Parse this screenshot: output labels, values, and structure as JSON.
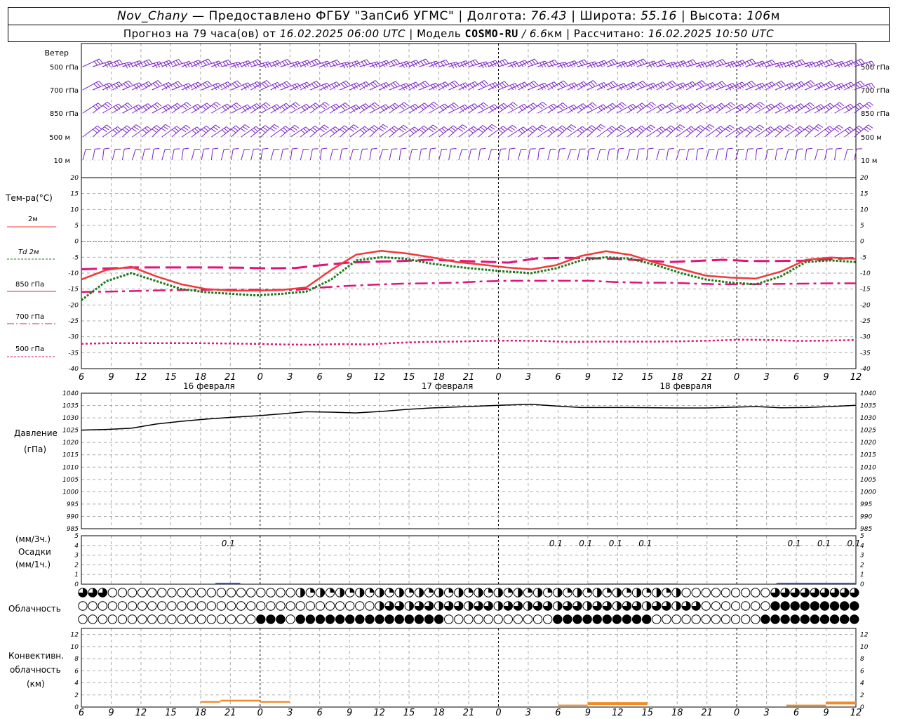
{
  "header": {
    "station": "Nov_Chany",
    "provider": "— Предоставлено ФГБУ \"ЗапСиб УГМС\"",
    "lon_label": "Долгота:",
    "lon_value": "76.43",
    "lat_label": "Широта:",
    "lat_value": "55.16",
    "alt_label": "Высота:",
    "alt_value": "106",
    "alt_unit": "м",
    "forecast_prefix": "Прогноз на 79 часа(ов) от",
    "forecast_time": "16.02.2025 06:00 UTC",
    "model_label": "| Модель",
    "model_name": "COSMO-RU",
    "model_res": "/ 6.6",
    "model_res_unit": "км",
    "computed_label": "| Рассчитано:",
    "computed_time": "16.02.2025 10:50 UTC"
  },
  "wind_panel": {
    "title": "Ветер",
    "levels": [
      "500 гПа",
      "700 гПа",
      "850 гПа",
      "500 м",
      "10  м"
    ]
  },
  "temp_panel": {
    "title": "Тем-ра(°C)",
    "legend": [
      {
        "label": "2м",
        "color": "#ee3a3a"
      },
      {
        "label": "Td  2м",
        "color": "#1a7a1a"
      },
      {
        "label": "850 гПа",
        "color": "#e0137a"
      },
      {
        "label": "700 гПа",
        "color": "#e0137a"
      },
      {
        "label": "500 гПа",
        "color": "#e0137a"
      }
    ],
    "y_ticks": [
      20,
      15,
      10,
      5,
      0,
      -5,
      -10,
      -15,
      -20,
      -25,
      -30,
      -35,
      -40
    ]
  },
  "pressure_panel": {
    "title": "Давление",
    "unit": "(гПа)",
    "y_ticks": [
      1040,
      1035,
      1030,
      1025,
      1020,
      1015,
      1010,
      1005,
      1000,
      995,
      990,
      985
    ]
  },
  "precip_panel": {
    "unit1": "(мм/3ч.)",
    "title": "Осадки",
    "unit2": "(мм/1ч.)",
    "y_ticks": [
      5,
      4,
      3,
      2,
      1,
      0
    ],
    "labels": [
      "0.1",
      "0.1",
      "0.1",
      "0.1",
      "0.1",
      "0.1",
      "0.1",
      "0.1"
    ]
  },
  "cloud_panel": {
    "title": "Облачность"
  },
  "conv_panel": {
    "title": [
      "Конвективн.",
      "облачность",
      "(км)"
    ],
    "y_ticks": [
      12,
      10,
      8,
      6,
      4,
      2,
      0
    ]
  },
  "x_axis": {
    "tick_labels": [
      "6",
      "9",
      "12",
      "15",
      "18",
      "21",
      "0",
      "3",
      "6",
      "9",
      "12",
      "15",
      "18",
      "21",
      "0",
      "3",
      "6",
      "9",
      "12",
      "15",
      "18",
      "21",
      "0",
      "3",
      "6",
      "9",
      "12"
    ],
    "dates": [
      "16 февраля",
      "17 февраля",
      "18 февраля"
    ]
  },
  "chart_data": {
    "type": "line",
    "x_hours": [
      0,
      3,
      6,
      9,
      12,
      15,
      18,
      21,
      24,
      27,
      30,
      33,
      36,
      39,
      42,
      45,
      48,
      51,
      54,
      57,
      60,
      63,
      66,
      69,
      72,
      75,
      78
    ],
    "series": [
      {
        "name": "2м",
        "color": "#ee3a3a",
        "values": [
          -12,
          -9,
          -8,
          -11,
          -13.5,
          -15,
          -15.5,
          -15.5,
          -15.3,
          -14.5,
          -9,
          -4.2,
          -3,
          -3.8,
          -5,
          -6.5,
          -7.3,
          -8.2,
          -8.8,
          -7.5,
          -4.6,
          -3.1,
          -4.3,
          -6.8,
          -8.7,
          -10.8,
          -11.4,
          -11.7,
          -9.5,
          -5.8,
          -5.1,
          -5.5
        ]
      },
      {
        "name": "Td  2м",
        "color": "#1a7a1a",
        "values": [
          -18.5,
          -12.5,
          -10,
          -12.5,
          -15,
          -16,
          -16.5,
          -17,
          -16.5,
          -15.8,
          -12,
          -6,
          -5,
          -5.5,
          -7,
          -8,
          -8.8,
          -9.5,
          -10,
          -8.5,
          -6,
          -5,
          -5.5,
          -7.5,
          -10,
          -12,
          -13,
          -13.5,
          -11,
          -6.5,
          -6,
          -6.5
        ]
      },
      {
        "name": "850 гПа",
        "color": "#e0137a",
        "values": [
          -8.8,
          -8.5,
          -8.2,
          -8.2,
          -8.2,
          -8.2,
          -8.3,
          -8.5,
          -8.4,
          -7.5,
          -6.7,
          -6.4,
          -6.2,
          -5.8,
          -6.1,
          -6.4,
          -6.7,
          -5.4,
          -5.2,
          -5.3,
          -5.5,
          -6,
          -6.5,
          -6.2,
          -5.8,
          -6.2,
          -6.2,
          -6.1,
          -5.6,
          -5.2
        ]
      },
      {
        "name": "700 гПа",
        "color": "#e0137a",
        "values": [
          -15.9,
          -15.8,
          -15.6,
          -15.4,
          -15.3,
          -15.2,
          -15.2,
          -15.2,
          -15.3,
          -14.5,
          -14,
          -13.6,
          -13.3,
          -13.2,
          -13,
          -12.6,
          -12.4,
          -12.4,
          -12.4,
          -12.4,
          -12.8,
          -13,
          -13,
          -13.3,
          -13.5,
          -13.5,
          -13.4,
          -13.3,
          -13.2,
          -13.2
        ]
      },
      {
        "name": "500 гПа",
        "color": "#e0137a",
        "values": [
          -32.2,
          -32,
          -32,
          -32,
          -32,
          -32.1,
          -32.2,
          -32.4,
          -32.5,
          -32.3,
          -32.4,
          -31.9,
          -31.6,
          -31.5,
          -31.3,
          -31.2,
          -31.3,
          -31.6,
          -31.5,
          -31.5,
          -31.5,
          -31.4,
          -31.2,
          -30.9,
          -31,
          -31.3,
          -31.2,
          -31
        ]
      }
    ],
    "pressure": [
      1025,
      1025.3,
      1025.8,
      1027.5,
      1028.6,
      1029.5,
      1030.2,
      1030.8,
      1031.6,
      1032.5,
      1032.3,
      1032,
      1032.6,
      1033.4,
      1034,
      1034.4,
      1034.8,
      1035.2,
      1035.5,
      1034.8,
      1034.2,
      1034.2,
      1034.2,
      1034.1,
      1034,
      1034,
      1034.3,
      1034.6,
      1034.1,
      1034.2,
      1034.6,
      1035.1
    ],
    "precip_mm": [
      0.1,
      0,
      0.05,
      0.05,
      0.05,
      0.1,
      0.1,
      0.1
    ],
    "ylim_temp": [
      -40,
      20
    ],
    "ylim_pressure": [
      985,
      1040
    ],
    "ylim_precip": [
      0,
      5
    ],
    "ylim_conv": [
      0,
      13
    ]
  }
}
